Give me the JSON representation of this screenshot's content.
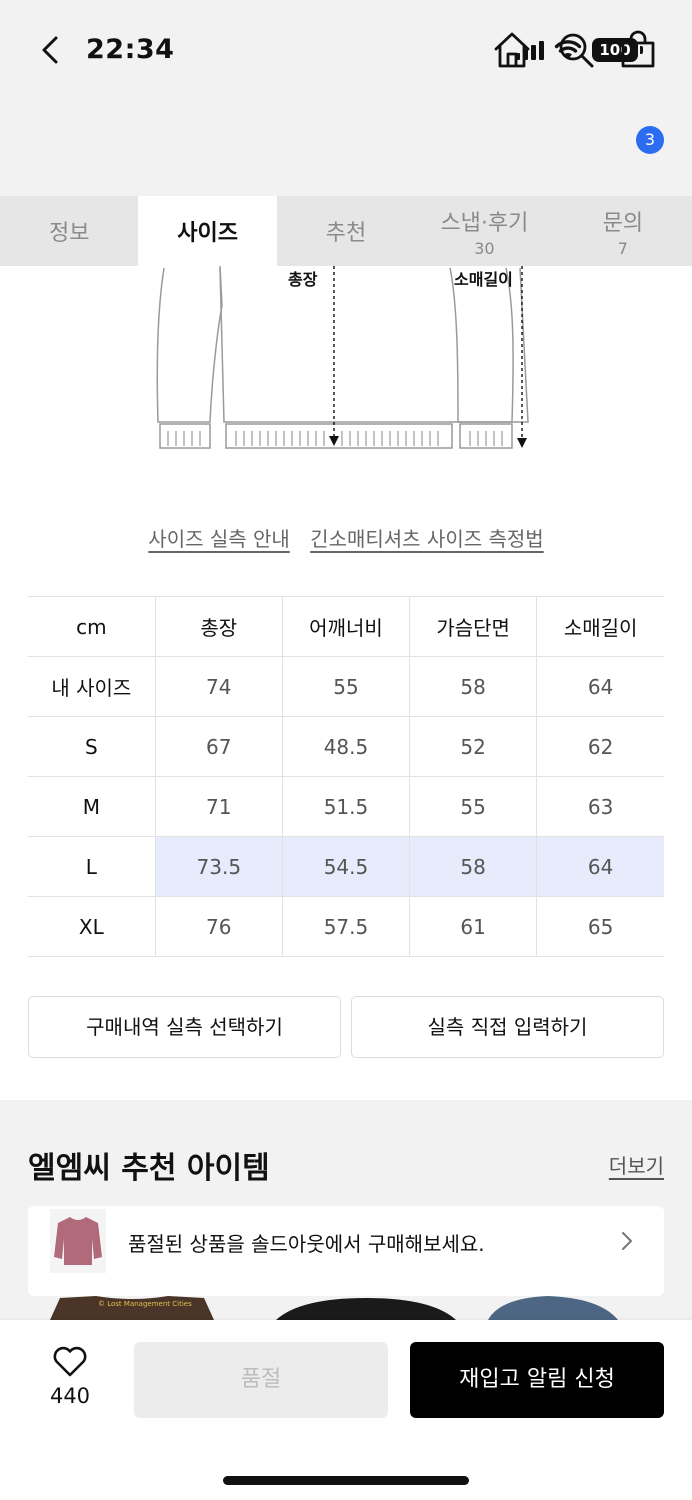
{
  "status_bar": {
    "time": "22:34",
    "battery": "100"
  },
  "header": {
    "cart_count": "3"
  },
  "tabs": [
    {
      "label": "정보",
      "count": ""
    },
    {
      "label": "사이즈",
      "count": ""
    },
    {
      "label": "추천",
      "count": ""
    },
    {
      "label": "스냅·후기",
      "count": "30"
    },
    {
      "label": "문의",
      "count": "7"
    }
  ],
  "illustration": {
    "length_label": "총장",
    "sleeve_label": "소매길이"
  },
  "size_links": {
    "guide": "사이즈 실측 안내",
    "method": "긴소매티셔츠 사이즈 측정법"
  },
  "size_table": {
    "unit": "cm",
    "headers": [
      "총장",
      "어깨너비",
      "가슴단면",
      "소매길이"
    ],
    "rows": [
      {
        "label": "내 사이즈",
        "values": [
          "74",
          "55",
          "58",
          "64"
        ]
      },
      {
        "label": "S",
        "values": [
          "67",
          "48.5",
          "52",
          "62"
        ]
      },
      {
        "label": "M",
        "values": [
          "71",
          "51.5",
          "55",
          "63"
        ]
      },
      {
        "label": "L",
        "values": [
          "73.5",
          "54.5",
          "58",
          "64"
        ]
      },
      {
        "label": "XL",
        "values": [
          "76",
          "57.5",
          "61",
          "65"
        ]
      }
    ],
    "highlight_color": "#e6ecfb"
  },
  "actions": {
    "purchase_history": "구매내역 실측 선택하기",
    "direct_input": "실측 직접 입력하기"
  },
  "recommend": {
    "title": "엘엠씨 추천 아이템",
    "more": "더보기",
    "soldout_banner": "품절된 상품을 솔드아웃에서 구매해보세요.",
    "thumb_caption": "© Lost Management Cities"
  },
  "bottom_bar": {
    "like_count": "440",
    "soldout": "품절",
    "restock": "재입고 알림 신청"
  },
  "colors": {
    "accent_blue": "#2b6cf0",
    "primary_black": "#000000",
    "tab_bg": "#e6e6e6"
  }
}
